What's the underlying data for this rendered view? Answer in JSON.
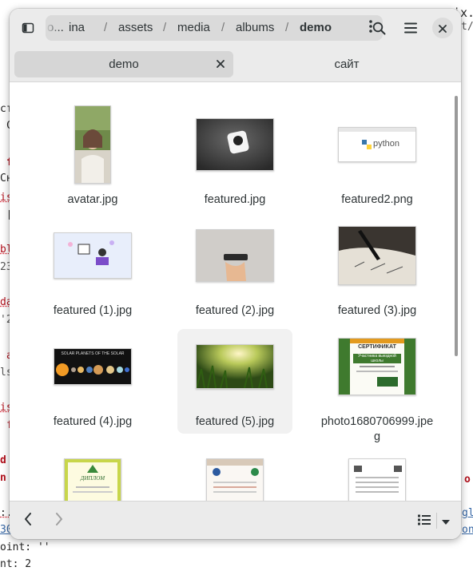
{
  "background": {
    "lines": [
      "ст",
      "С",
      "f",
      "Сн",
      "is",
      "[",
      "bl",
      "23",
      "da",
      "'2",
      "a",
      "ls",
      "is",
      "f",
      "d",
      "n",
      "ix.m",
      "t/p",
      ":.",
      "30",
      "o",
      "gl",
      "on"
    ],
    "footer1": "oint: ''",
    "footer2": "nt: 2"
  },
  "window": {
    "pathbar": {
      "segments": [
        "o...",
        "ina",
        "assets",
        "media",
        "albums",
        "demo"
      ],
      "separator": "/"
    },
    "tabs": [
      {
        "label": "demo",
        "active": true
      },
      {
        "label": "сайт",
        "active": false
      }
    ],
    "files": [
      {
        "name": "avatar.jpg"
      },
      {
        "name": "featured.jpg"
      },
      {
        "name": "featured2.png"
      },
      {
        "name": "featured (1).jpg"
      },
      {
        "name": "featured (2).jpg"
      },
      {
        "name": "featured (3).jpg"
      },
      {
        "name": "featured (4).jpg"
      },
      {
        "name": "featured (5).jpg",
        "selected": true
      },
      {
        "name": "photo1680706999.jpeg"
      },
      {
        "name": ""
      },
      {
        "name": ""
      },
      {
        "name": ""
      }
    ],
    "thumb_text": {
      "python": "python",
      "planets": "SOLAR PLANETS OF THE SOLAR",
      "cert_title": "СЕРТИФИКАТ",
      "cert_sub": "Участника выездной школы",
      "diploma": "ДИПЛОМ"
    }
  },
  "icons": {
    "sidebar": "sidebar-toggle-icon",
    "kebab": "more-vertical-icon",
    "search": "search-icon",
    "menu": "hamburger-menu-icon",
    "close": "close-icon",
    "back": "chevron-left-icon",
    "forward": "chevron-right-icon",
    "list_view": "list-view-icon",
    "view_options": "chevron-down-icon"
  },
  "colors": {
    "headerbar": "#ebebeb",
    "pathbar": "#dadada",
    "active_tab": "#d6d6d6",
    "selection": "#f1f1f1"
  }
}
